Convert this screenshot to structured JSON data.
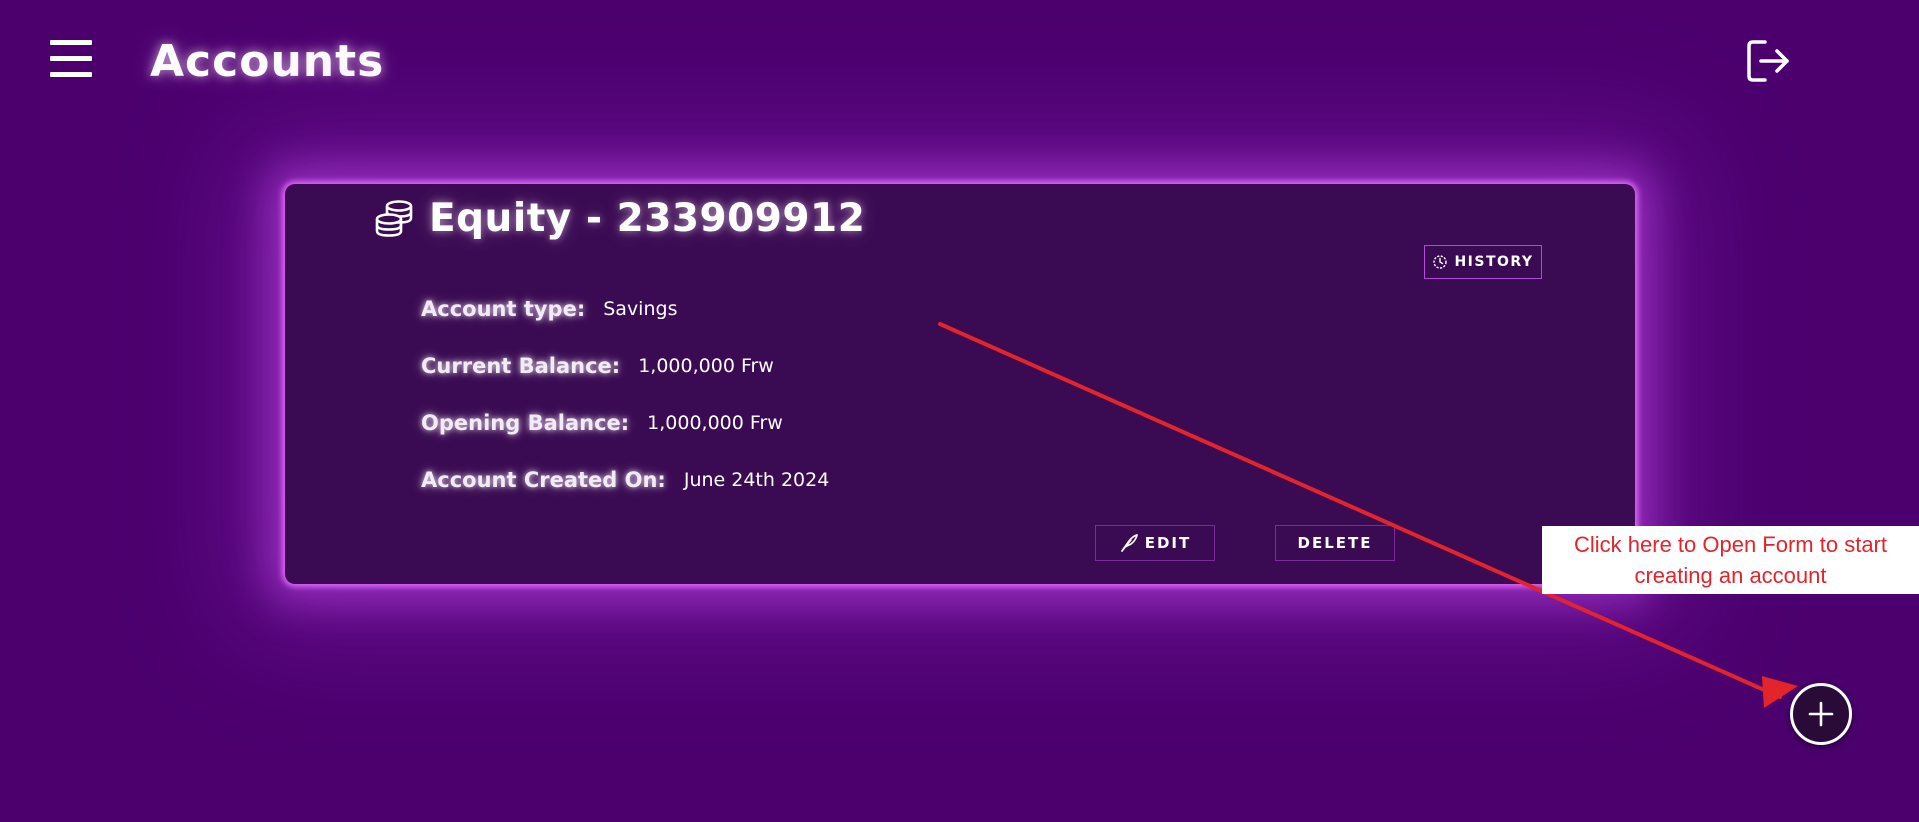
{
  "header": {
    "title": "Accounts",
    "menu_icon": "hamburger-menu-icon",
    "logout_icon": "logout-icon"
  },
  "account_card": {
    "bank_icon": "coins-stack-icon",
    "title": "Equity - 233909912",
    "history_label": "HISTORY",
    "history_icon": "clock-history-icon",
    "details": [
      {
        "label": "Account type:",
        "value": "Savings"
      },
      {
        "label": "Current Balance:",
        "value": "1,000,000 Frw"
      },
      {
        "label": "Opening Balance:",
        "value": "1,000,000 Frw"
      },
      {
        "label": "Account Created On:",
        "value": "June 24th 2024"
      }
    ],
    "edit_label": "EDIT",
    "edit_icon": "feather-pen-icon",
    "delete_label": "DELETE"
  },
  "annotation": {
    "callout_text": "Click here to Open Form to start creating an account",
    "arrow_color": "#e3242b"
  },
  "fab": {
    "icon": "plus-icon"
  },
  "colors": {
    "background": "#4b006e",
    "card": "#3a0b52",
    "glow": "#d070f0",
    "annotation_red": "#e3242b"
  }
}
